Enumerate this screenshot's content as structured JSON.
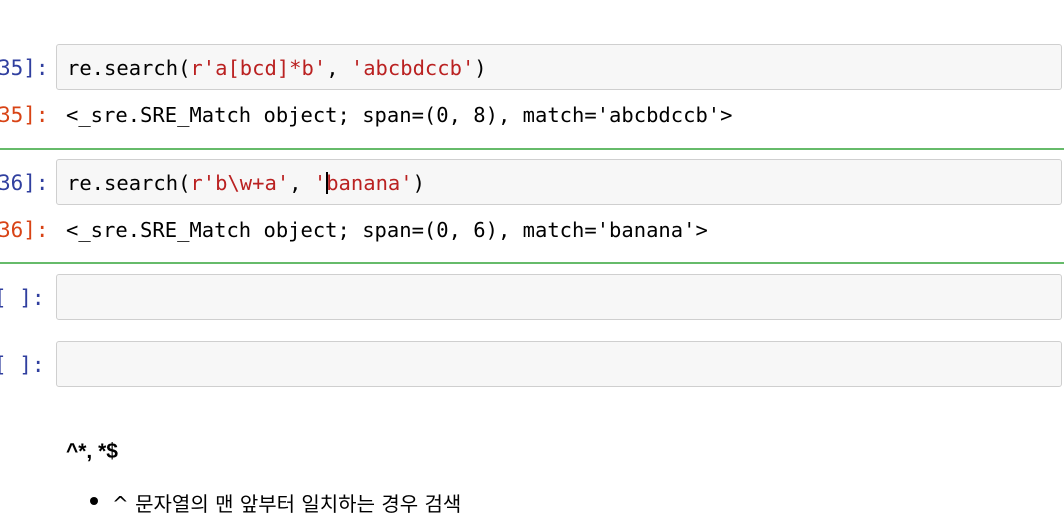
{
  "cells": [
    {
      "in_prompt": "35]:",
      "code_fn": "re.search(",
      "code_arg1": "r'a[bcd]*b'",
      "code_sep": ", ",
      "code_arg2": "'abcbdccb'",
      "code_end": ")",
      "out_prompt": "35]:",
      "output": "<_sre.SRE_Match object; span=(0, 8), match='abcbdccb'>"
    },
    {
      "in_prompt": "36]:",
      "code_fn": "re.search(",
      "code_arg1": "r'b\\w+a'",
      "code_sep": ", ",
      "code_arg2_pre": "'",
      "code_arg2_post": "banana'",
      "code_end": ")",
      "out_prompt": "36]:",
      "output": "<_sre.SRE_Match object; span=(0, 6), match='banana'>"
    },
    {
      "in_prompt": "[ ]:"
    },
    {
      "in_prompt": "[ ]:"
    }
  ],
  "markdown": {
    "heading": "^*, *$",
    "bullets": [
      "^ 문자열의 맨 앞부터 일치하는 경우 검색"
    ]
  },
  "colors": {
    "in_prompt": "#303f9f",
    "out_prompt": "#d84315",
    "string": "#ba2121",
    "divider": "#66bb6a"
  }
}
